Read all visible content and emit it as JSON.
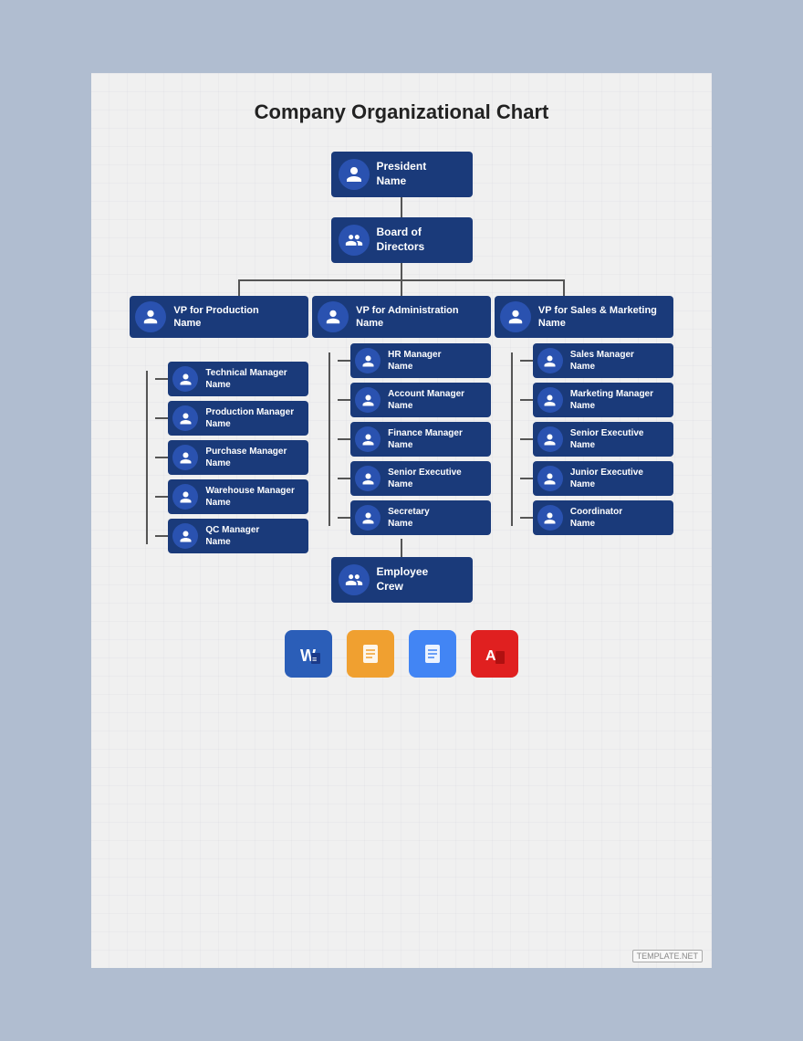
{
  "page": {
    "title": "Company Organizational Chart",
    "background": "#b0bdd0",
    "paper_bg": "#f0f0f0"
  },
  "chart": {
    "president": {
      "title": "President",
      "subtitle": "Name"
    },
    "board": {
      "title": "Board of",
      "subtitle": "Directors"
    },
    "vp_production": {
      "title": "VP for Production",
      "subtitle": "Name"
    },
    "vp_administration": {
      "title": "VP for Administration",
      "subtitle": "Name"
    },
    "vp_sales": {
      "title": "VP for Sales & Marketing",
      "subtitle": "Name"
    },
    "production_subs": [
      {
        "title": "Technical Manager",
        "subtitle": "Name"
      },
      {
        "title": "Production Manager",
        "subtitle": "Name"
      },
      {
        "title": "Purchase Manager",
        "subtitle": "Name"
      },
      {
        "title": "Warehouse Manager",
        "subtitle": "Name"
      },
      {
        "title": "QC Manager",
        "subtitle": "Name"
      }
    ],
    "admin_subs": [
      {
        "title": "HR Manager",
        "subtitle": "Name"
      },
      {
        "title": "Account Manager",
        "subtitle": "Name"
      },
      {
        "title": "Finance Manager",
        "subtitle": "Name"
      },
      {
        "title": "Senior Executive",
        "subtitle": "Name"
      },
      {
        "title": "Secretary",
        "subtitle": "Name"
      }
    ],
    "sales_subs": [
      {
        "title": "Sales Manager",
        "subtitle": "Name"
      },
      {
        "title": "Marketing Manager",
        "subtitle": "Name"
      },
      {
        "title": "Senior Executive",
        "subtitle": "Name"
      },
      {
        "title": "Junior Executive",
        "subtitle": "Name"
      },
      {
        "title": "Coordinator",
        "subtitle": "Name"
      }
    ],
    "employee_crew": {
      "title": "Employee",
      "subtitle": "Crew"
    }
  },
  "bottom_icons": [
    {
      "type": "word",
      "label": "W"
    },
    {
      "type": "pages",
      "label": "✎"
    },
    {
      "type": "docs",
      "label": "≡"
    },
    {
      "type": "pdf",
      "label": "A"
    }
  ],
  "watermark": "TEMPLATE.NET"
}
